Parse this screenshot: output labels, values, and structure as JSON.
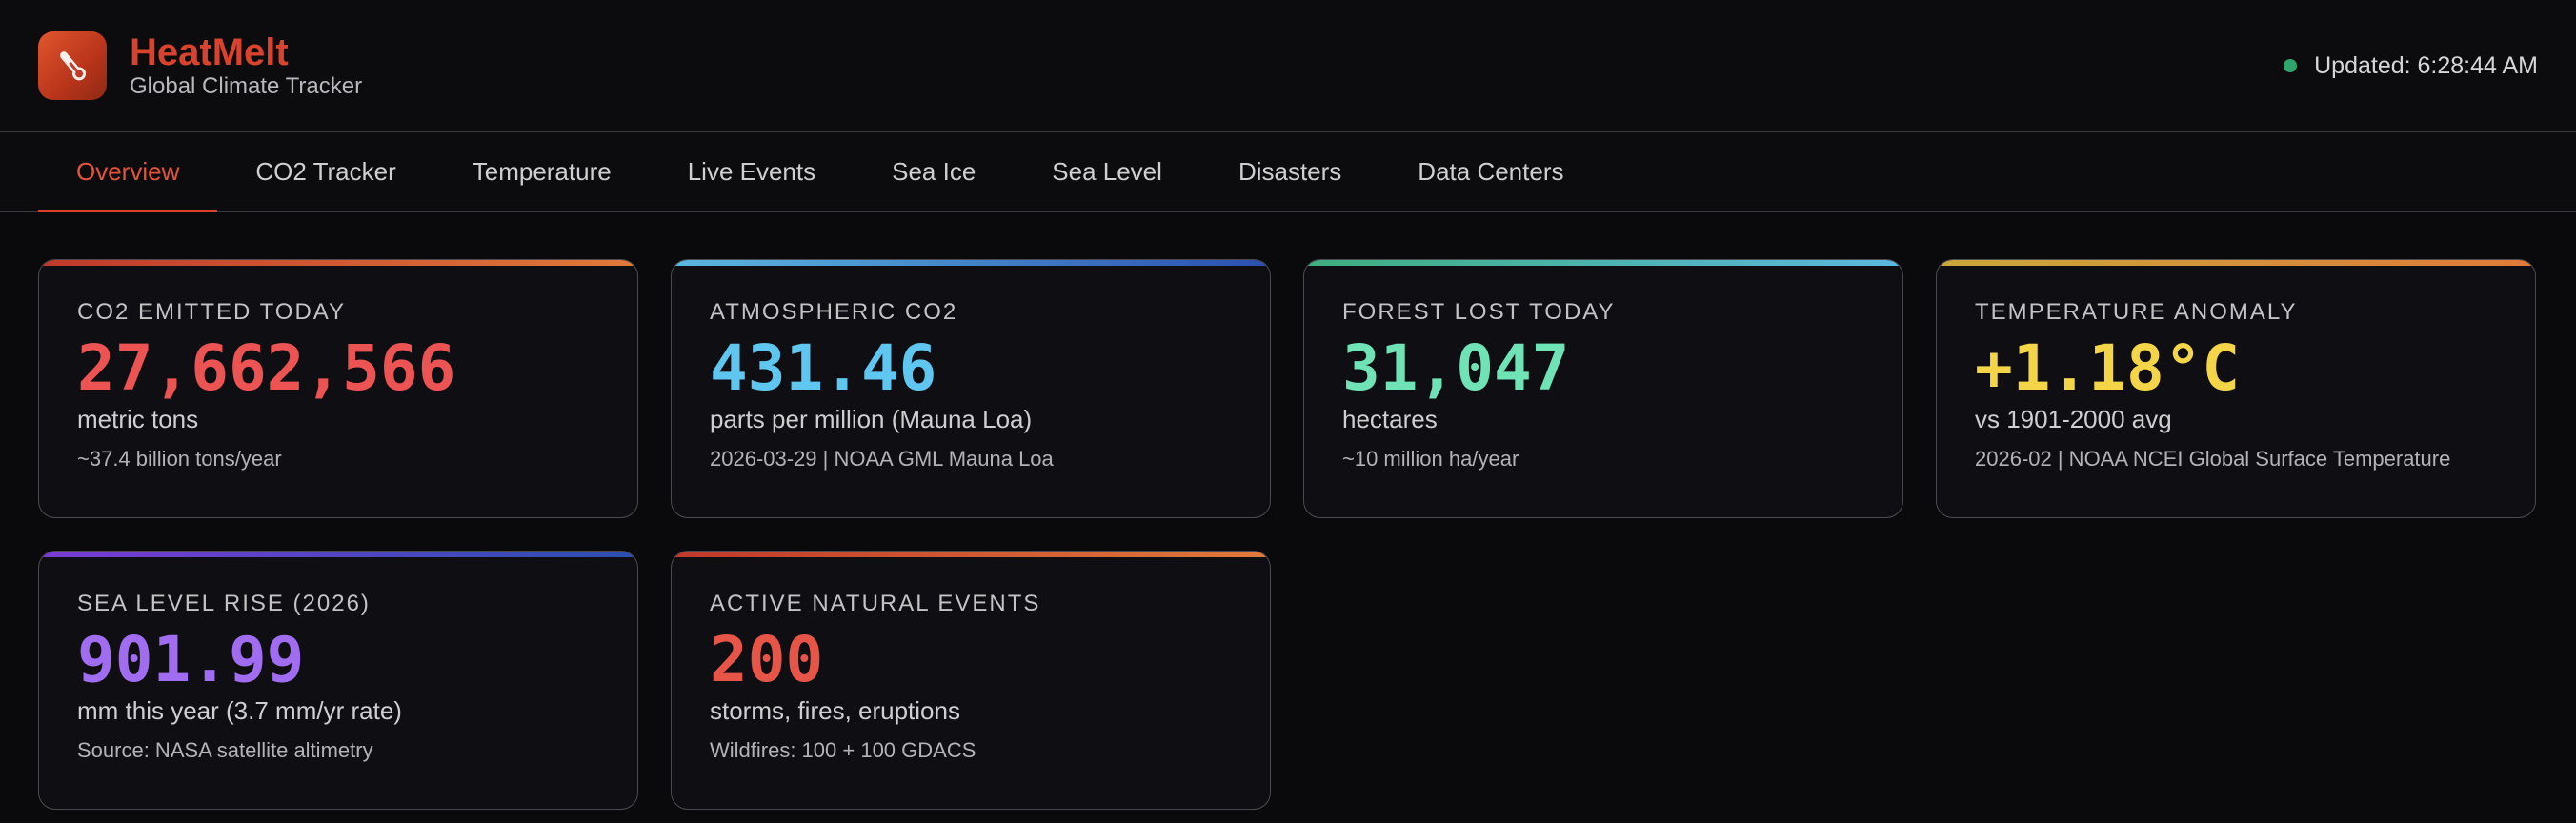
{
  "app": {
    "title": "HeatMelt",
    "subtitle": "Global Climate Tracker",
    "status": "Updated: 6:28:44 AM"
  },
  "nav": {
    "tabs": [
      {
        "label": "Overview",
        "active": true
      },
      {
        "label": "CO2 Tracker",
        "active": false
      },
      {
        "label": "Temperature",
        "active": false
      },
      {
        "label": "Live Events",
        "active": false
      },
      {
        "label": "Sea Ice",
        "active": false
      },
      {
        "label": "Sea Level",
        "active": false
      },
      {
        "label": "Disasters",
        "active": false
      },
      {
        "label": "Data Centers",
        "active": false
      }
    ]
  },
  "cards": [
    {
      "label": "CO2 EMITTED TODAY",
      "value": "27,662,566",
      "unit": "metric tons",
      "note": "~37.4 billion tons/year",
      "value_color": "#ec5353",
      "accent": [
        "#c0392b",
        "#e07a3a"
      ]
    },
    {
      "label": "ATMOSPHERIC CO2",
      "value": "431.46",
      "unit": "parts per million (Mauna Loa)",
      "note": "2026-03-29 | NOAA GML Mauna Loa",
      "value_color": "#5fc6f0",
      "accent": [
        "#5bb8e0",
        "#2b4fb0"
      ]
    },
    {
      "label": "FOREST LOST TODAY",
      "value": "31,047",
      "unit": "hectares",
      "note": "~10 million ha/year",
      "value_color": "#6fe3b5",
      "accent": [
        "#3fae7e",
        "#5bb8e0"
      ]
    },
    {
      "label": "TEMPERATURE ANOMALY",
      "value": "+1.18°C",
      "unit": "vs 1901-2000 avg",
      "note": "2026-02 | NOAA NCEI Global Surface Temperature",
      "value_color": "#f5d548",
      "accent": [
        "#c9a83a",
        "#e07a3a"
      ]
    },
    {
      "label": "SEA LEVEL RISE (2026)",
      "value": "901.99",
      "unit": "mm this year (3.7 mm/yr rate)",
      "note": "Source: NASA satellite altimetry",
      "value_color": "#a06cf0",
      "accent": [
        "#7a3bd6",
        "#2b4fb0"
      ]
    },
    {
      "label": "ACTIVE NATURAL EVENTS",
      "value": "200",
      "unit": "storms, fires, eruptions",
      "note": "Wildfires: 100 + 100 GDACS",
      "value_color": "#e65548",
      "accent": [
        "#c0392b",
        "#e07a3a"
      ]
    }
  ]
}
